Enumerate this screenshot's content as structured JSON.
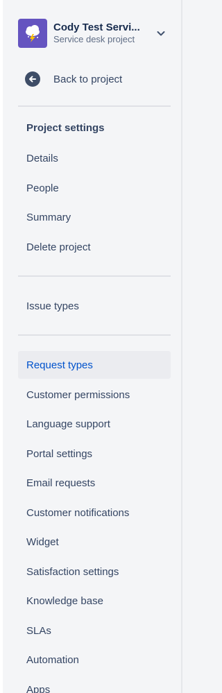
{
  "project": {
    "name": "Cody Test Servi...",
    "type": "Service desk project",
    "avatar_icon": "storm-cloud-icon",
    "avatar_color": "#6554c0"
  },
  "back": {
    "label": "Back to project",
    "icon": "arrow-left-circle-icon"
  },
  "settings": {
    "title": "Project settings",
    "items": [
      "Details",
      "People",
      "Summary",
      "Delete project"
    ]
  },
  "issue_section": {
    "items": [
      "Issue types"
    ]
  },
  "service_section": {
    "items": [
      "Request types",
      "Customer permissions",
      "Language support",
      "Portal settings",
      "Email requests",
      "Customer notifications",
      "Widget",
      "Satisfaction settings",
      "Knowledge base",
      "SLAs",
      "Automation",
      "Apps"
    ],
    "active_item": "Request types"
  },
  "colors": {
    "active_text": "#0052cc",
    "active_bg": "#ebecf0",
    "text": "#344563",
    "background": "#f4f5f7"
  }
}
